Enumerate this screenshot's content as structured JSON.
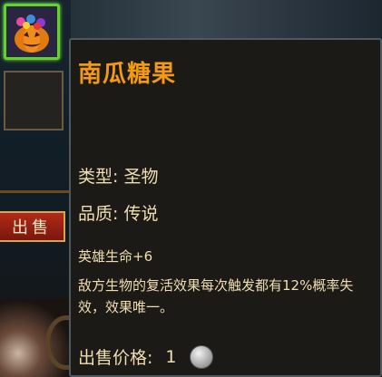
{
  "tooltip": {
    "item_name": "南瓜糖果",
    "type_label": "类型:",
    "type_value": "圣物",
    "quality_label": "品质:",
    "quality_value": "传说",
    "effect_title": "英雄生命+6",
    "effect_desc": "敌方生物的复活效果每次触发都有12%概率失效，效果唯一。",
    "price_label": "出售价格:",
    "price_value": "1",
    "price_icon": "silver-coin-icon"
  },
  "inventory": {
    "sell_label": "出售",
    "selected_item_icon": "pumpkin-candy-icon"
  },
  "colors": {
    "item_name": "#f39a12",
    "text": "#f0ddb0",
    "selected_border": "#63d22a",
    "sell_button": "#9a2213"
  }
}
